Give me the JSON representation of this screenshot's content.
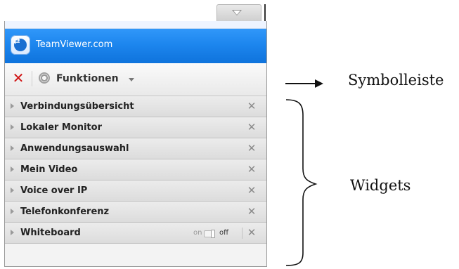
{
  "app": {
    "title": "TeamViewer.com"
  },
  "toolbar": {
    "functions_label": "Funktionen"
  },
  "widgets": [
    {
      "label": "Verbindungsübersicht"
    },
    {
      "label": "Lokaler Monitor"
    },
    {
      "label": "Anwendungsauswahl"
    },
    {
      "label": "Mein Video"
    },
    {
      "label": "Voice over IP"
    },
    {
      "label": "Telefonkonferenz"
    },
    {
      "label": "Whiteboard",
      "toggle": {
        "on": "on",
        "off": "off",
        "state": "off"
      }
    }
  ],
  "annotations": {
    "toolbar": "Symbolleiste",
    "widgets": "Widgets"
  },
  "icons": {
    "collapse": "chevron-down-icon",
    "logo": "teamviewer-logo-icon",
    "close": "close-icon",
    "functions": "gear-icon",
    "dropdown": "caret-down-icon",
    "expand": "triangle-right-icon",
    "widget_close": "close-icon"
  },
  "colors": {
    "header_blue": "#1d86ee",
    "close_red": "#d01414"
  }
}
